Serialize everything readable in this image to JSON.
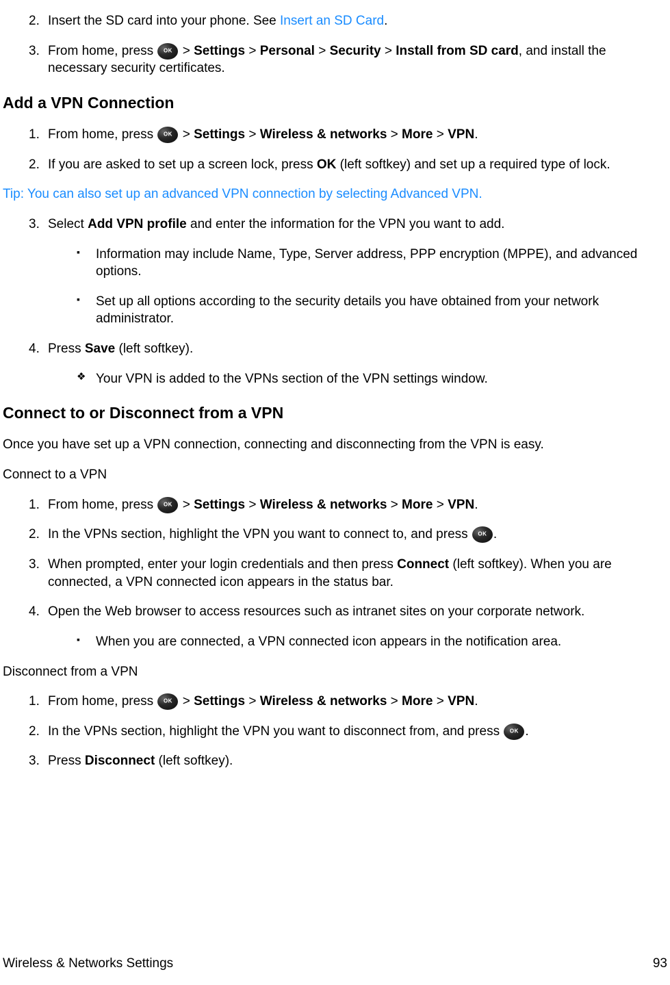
{
  "section1": {
    "items": [
      {
        "num": "2.",
        "prefix": "Insert the SD card into your phone. See ",
        "link": "Insert an SD Card",
        "suffix": "."
      },
      {
        "num": "3.",
        "prefix": "From home, press ",
        "path": [
          " > ",
          "Settings",
          " > ",
          "Personal",
          " > ",
          "Security",
          " > ",
          "Install from SD card"
        ],
        "suffix": ", and install the necessary security certificates."
      }
    ]
  },
  "heading1": "Add a VPN Connection",
  "section2a": {
    "items": [
      {
        "num": "1.",
        "prefix": "From home, press ",
        "path": [
          " > ",
          "Settings",
          " > ",
          "Wireless & networks",
          " > ",
          "More",
          " > ",
          "VPN"
        ],
        "suffix": "."
      },
      {
        "num": "2.",
        "text_before": "If you are asked to set up a screen lock, press ",
        "bold1": "OK",
        "text_after": " (left softkey) and set up a required type of lock."
      }
    ]
  },
  "tip": {
    "label": "Tip",
    "text": ": You can also set up an advanced VPN connection by selecting Advanced VPN."
  },
  "section2b": {
    "items": [
      {
        "num": "3.",
        "text_before": "Select ",
        "bold1": "Add VPN profile",
        "text_after": " and enter the information for the VPN you want to add.",
        "sub": [
          "Information may include Name, Type, Server address, PPP encryption (MPPE), and advanced options.",
          "Set up all options according to the security details you have obtained from your network administrator."
        ]
      },
      {
        "num": "4.",
        "text_before": "Press ",
        "bold1": "Save",
        "text_after": " (left softkey).",
        "sub_diamond": [
          "Your VPN is added to the VPNs section of the VPN settings window."
        ]
      }
    ]
  },
  "heading2": "Connect to or Disconnect from a VPN",
  "intro2": "Once you have set up a VPN connection, connecting and disconnecting from the VPN is easy.",
  "sub_connect": "Connect to a VPN",
  "section3": {
    "items": [
      {
        "num": "1.",
        "prefix": "From home, press ",
        "path": [
          " > ",
          "Settings",
          " > ",
          "Wireless & networks",
          " > ",
          "More",
          " > ",
          "VPN"
        ],
        "suffix": "."
      },
      {
        "num": "2.",
        "text": "In the VPNs section, highlight the VPN you want to connect to, and press ",
        "icon_after": true,
        "suffix": "."
      },
      {
        "num": "3.",
        "text_before": "When prompted, enter your login credentials and then press ",
        "bold1": "Connect",
        "text_after": " (left softkey). When you are connected, a VPN connected icon appears in the status bar."
      },
      {
        "num": "4.",
        "text": "Open the Web browser to access resources such as intranet sites on your corporate network.",
        "sub": [
          "When you are connected, a VPN connected icon appears in the notification area."
        ]
      }
    ]
  },
  "sub_disconnect": "Disconnect from a VPN",
  "section4": {
    "items": [
      {
        "num": "1.",
        "prefix": "From home, press ",
        "path": [
          " > ",
          "Settings",
          " > ",
          "Wireless & networks",
          " > ",
          "More",
          " > ",
          "VPN"
        ],
        "suffix": "."
      },
      {
        "num": "2.",
        "text": "In the VPNs section, highlight the VPN you want to disconnect from, and press ",
        "icon_after": true,
        "suffix": "."
      },
      {
        "num": "3.",
        "text_before": "Press ",
        "bold1": "Disconnect",
        "text_after": " (left softkey)."
      }
    ]
  },
  "footer": {
    "left": "Wireless & Networks Settings",
    "right": "93"
  }
}
